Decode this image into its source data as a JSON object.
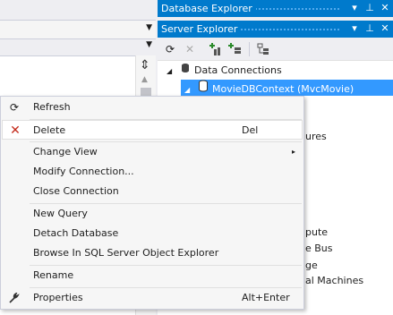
{
  "database_explorer": {
    "title": "Database Explorer",
    "buttons": {
      "dropdown": "▾",
      "pin": "⊥",
      "close": "✕"
    }
  },
  "server_explorer": {
    "title": "Server Explorer",
    "buttons": {
      "dropdown": "▾",
      "pin": "⊥",
      "close": "✕"
    },
    "tree": {
      "data_connections": "Data Connections",
      "selected_connection": "MovieDBContext (MvcMovie)",
      "partial_labels": [
        "ures",
        "pute",
        "e Bus",
        "ge",
        "al Machines"
      ]
    }
  },
  "context_menu": {
    "items": [
      {
        "label": "Refresh",
        "shortcut": "",
        "icon": "refresh-icon"
      },
      {
        "label": "Delete",
        "shortcut": "Del",
        "icon": "delete-x-icon"
      },
      {
        "label": "Change View",
        "shortcut": "",
        "icon": "",
        "submenu": "▸"
      },
      {
        "label": "Modify Connection...",
        "shortcut": "",
        "icon": ""
      },
      {
        "label": "Close Connection",
        "shortcut": "",
        "icon": ""
      },
      {
        "label": "New Query",
        "shortcut": "",
        "icon": ""
      },
      {
        "label": "Detach Database",
        "shortcut": "",
        "icon": ""
      },
      {
        "label": "Browse In SQL Server Object Explorer",
        "shortcut": "",
        "icon": ""
      },
      {
        "label": "Rename",
        "shortcut": "",
        "icon": ""
      },
      {
        "label": "Properties",
        "shortcut": "Alt+Enter",
        "icon": "wrench-icon"
      }
    ]
  },
  "colors": {
    "accent": "#007acc",
    "selection": "#3399ff",
    "delete_red": "#c42b1c"
  }
}
